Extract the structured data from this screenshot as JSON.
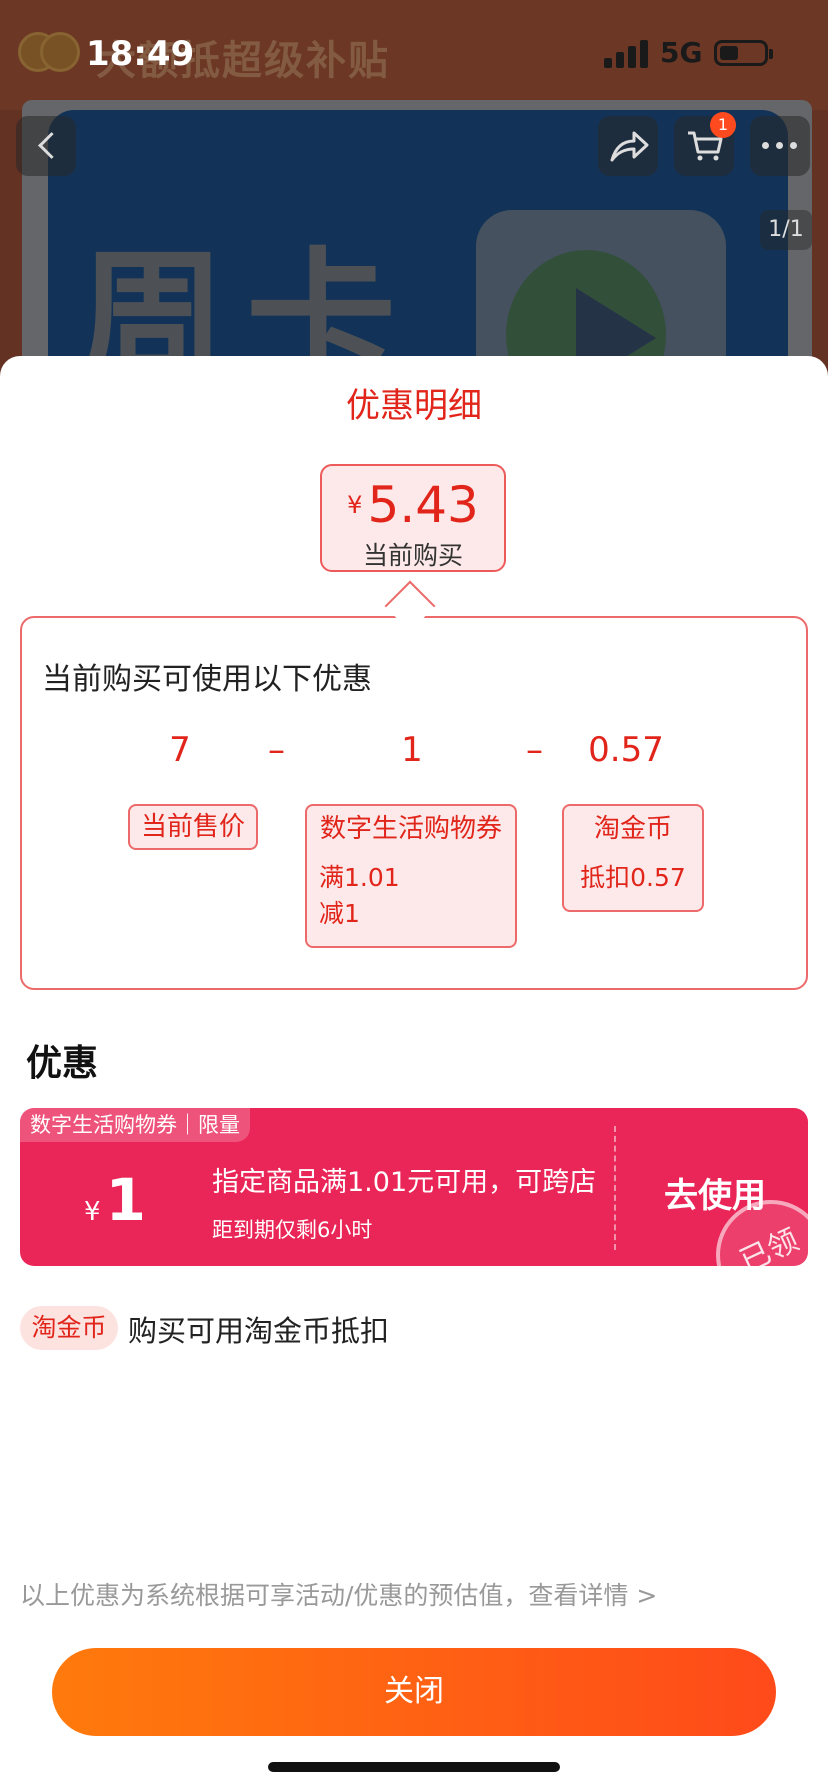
{
  "status_bar": {
    "time": "18:49",
    "network": "5G"
  },
  "background": {
    "banner_text": "大额抵超级补贴",
    "card_text": "周卡",
    "cart_badge": "1",
    "page_indicator": "1/1"
  },
  "sheet": {
    "title": "优惠明细",
    "price": {
      "symbol": "¥",
      "value": "5.43",
      "label": "当前购买"
    },
    "calc": {
      "title": "当前购买可使用以下优惠",
      "items": [
        {
          "value": "7",
          "label": "当前售价"
        },
        {
          "value": "1",
          "label": "数字生活购物券",
          "detail_line1": "满1.01",
          "detail_line2": "减1"
        },
        {
          "value": "0.57",
          "label": "淘金币",
          "detail_line1": "抵扣0.57"
        }
      ],
      "operator": "–"
    },
    "section_title": "优惠",
    "coupon": {
      "tag": "数字生活购物券｜限量",
      "symbol": "¥",
      "amount": "1",
      "description": "指定商品满1.01元可用，可跨店",
      "expiry": "距到期仅剩6小时",
      "action": "去使用",
      "stamp": "已领"
    },
    "coin": {
      "chip": "淘金币",
      "text": "购买可用淘金币抵扣"
    },
    "footnote": "以上优惠为系统根据可享活动/优惠的预估值，查看详情 >",
    "close_label": "关闭"
  },
  "colors": {
    "accent": "#e1251b",
    "coupon_bg": "#ea2557",
    "button_start": "#ff7a0c",
    "button_end": "#ff4a1a"
  }
}
